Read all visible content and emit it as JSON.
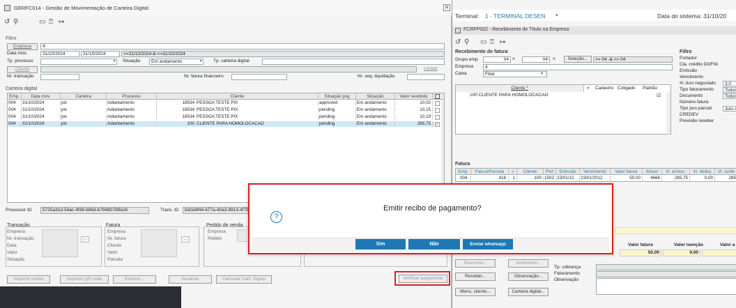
{
  "left": {
    "title": "GERFC014 - Gestão de Movimentação de Carteira Digital",
    "filter_title": "Filtro",
    "empresa_label": "Empresa",
    "empresa_value": "4",
    "datamov_label": "Data mov.",
    "date_from": "31/10/2024",
    "date_to": "31/10/2024",
    "date_expr": ">=31/10/2024-&-<=31/10/2024",
    "tpproc_label": "Tp. processo",
    "situacao_label": "Situação",
    "situacao_value": "Em andamento",
    "tpcart_label": "Tp. carteira digital",
    "cliente_label": "Cliente",
    "limpar": "Limpar",
    "nrtrans_label": "Nr. transação",
    "nrfatura_label": "Nr. fatura financeiro",
    "nrseq_label": "Nr. seq. liquidação",
    "grid_title": "Carteira digital",
    "cols": [
      "Emp.",
      "Data mov.",
      "Carteira",
      "Processo",
      "Cliente",
      "Situação psg",
      "Situação",
      "Valor recebido"
    ],
    "rows": [
      [
        "004",
        "31/10/2024",
        "pix",
        "Adiantamento",
        "18534",
        "PESSOA TESTE PIX",
        "approved",
        "Em andamento",
        "10,02"
      ],
      [
        "004",
        "31/10/2024",
        "pix",
        "Adiantamento",
        "18534",
        "PESSOA TESTE PIX",
        "pending",
        "Em andamento",
        "10,15"
      ],
      [
        "004",
        "31/10/2024",
        "pix",
        "Adiantamento",
        "18534",
        "PESSOA TESTE PIX",
        "pending",
        "Em andamento",
        "10,19"
      ],
      [
        "004",
        "31/10/2024",
        "pix",
        "Adiantamento",
        "100",
        "CLIENTE PARA HOMOLOCACAO",
        "pending",
        "Em andamento",
        "285,75"
      ]
    ],
    "processor_label": "Processor ID",
    "processor_value": "5725a31d-54ac-4f36-b96d-b79480789e26",
    "trans_label": "Trans. ID",
    "trans_value": "bd2e9f44-677a-40a3-8913-4f79f0e4f1",
    "transacao_title": "Transação",
    "transacao_fields": [
      "Empresa",
      "Nr. transação",
      "Data",
      "Valor",
      "Situação"
    ],
    "fatura_title": "Fatura",
    "fatura_fields": [
      "Empresa",
      "Nr. fatura",
      "Cliente",
      "Valor",
      "Parcela"
    ],
    "pedido_title": "Pedido de venda",
    "pedido_fields": [
      "Empresa",
      "Pedido"
    ],
    "btn_imprimir": "Imprimir recibo",
    "btn_qr": "Imprimir QR code",
    "btn_estorno": "Estorno...",
    "btn_atualizar": "Atualizar",
    "btn_cancelar": "Cancelar Cart. Digital",
    "btn_verificar": "Verificar pagamento"
  },
  "right": {
    "terminal_label": "Terminal:",
    "terminal_value": "1 - TERMINAL DESEN",
    "data_sistema": "Data do sistema: 31/10/20",
    "title": "FCRFP002 - Recebimento de Título na Empresa",
    "receb_title": "Recebimento de fatura",
    "grupo_label": "Grupo emp.",
    "grupo_a": "04",
    "grupo_b": "04",
    "selecao": "Seleção...",
    "selecao_expr": ">= 04 -& <= 04",
    "empresa_label": "Empresa",
    "empresa_value": "4",
    "caixa_label": "Caixa",
    "caixa_value": "Filial",
    "cliente_hdr": "Cliente *",
    "cadastro": "Cadastro",
    "coligado": "Coligado",
    "padrao": "Padrão",
    "cliente_row": "100 CLIENTE PARA HOMOLOCACAO",
    "filtro_title": "Filtro",
    "filtro_fields": [
      "Portador",
      "Cla. crédito DOFNI",
      "Emissão",
      "Vencimento",
      "% Juro negociado",
      "Tipo faturamento",
      "Documento",
      "Número fatura",
      "Tipo juro parcial",
      "CREDEV",
      "Previsão receber"
    ],
    "filtro_values": [
      "",
      "",
      "",
      "",
      "3,0",
      "Todos",
      "Todos",
      "",
      "Juro n",
      "",
      ""
    ],
    "fatura_title": "Fatura",
    "fat_cols": [
      "Emp.",
      "Fatura/Parcela",
      "»",
      "Cliente",
      "Port",
      "Emissão",
      "Vencimento",
      "Valor fatura",
      "Atraso",
      "Vl. acresc.",
      "Vl. deduç",
      "Vl. confe"
    ],
    "fat_row": [
      "004",
      "418",
      "1",
      "100",
      "1502",
      "23/01/12",
      "23/01/2012",
      "50,00",
      "4666",
      "285,75",
      "0,00",
      "285"
    ],
    "valor_fatura_label": "Valor fatura",
    "valor_fatura": "50,00",
    "valor_isencao_label": "Valor isenção",
    "valor_isencao": "0,00",
    "valor_a_label": "Valor a",
    "btn_desconto": "Desconto...",
    "btn_acrescimo": "Acréscimo...",
    "btn_receber": "Receber...",
    "btn_observacao": "Observação...",
    "btn_mens": "Mens. cliente...",
    "btn_carteira": "Carteira digital...",
    "tp_cobranca": "Tp. cobrança",
    "faturamento": "Faturamento",
    "observacao": "Observação"
  },
  "dialog": {
    "message": "Emitir recibo de pagamento?",
    "sim": "Sim",
    "nao": "Não",
    "whats": "Enviar whatsapp"
  },
  "colors": {
    "accent": "#1e78b4",
    "highlight": "#e31b1b",
    "selected_row": "#cfe8f6"
  }
}
